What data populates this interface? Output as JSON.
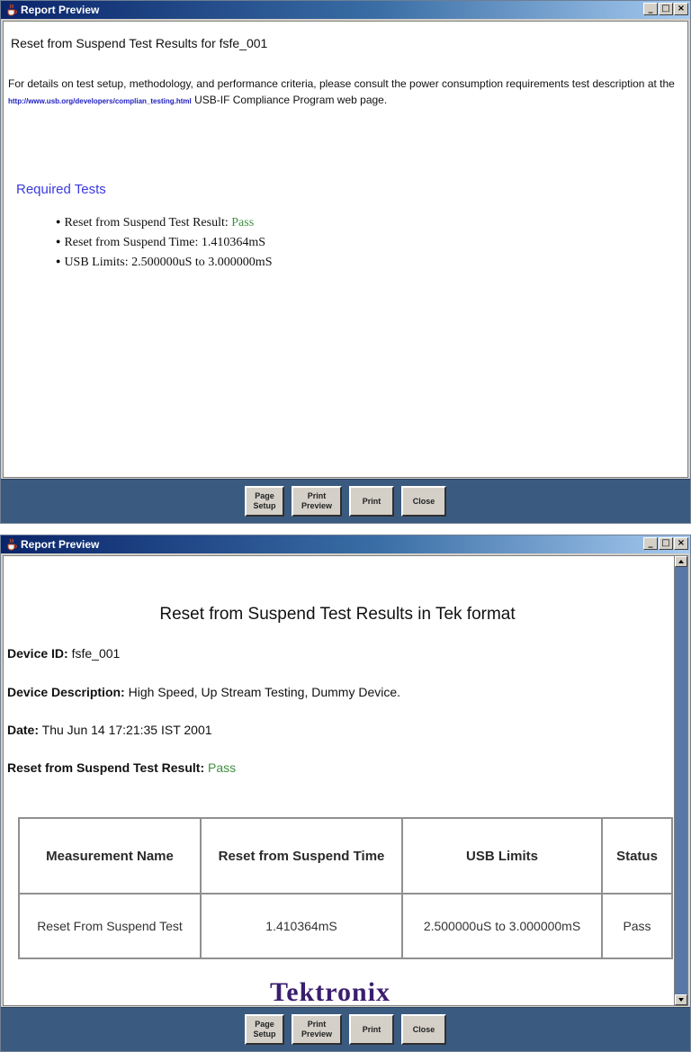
{
  "window1": {
    "title": "Report Preview",
    "heading": "Reset from Suspend Test Results for fsfe_001",
    "intro_before": "For details on test setup, methodology, and performance criteria, please consult the power consumption requirements test description at the",
    "url": "http://www.usb.org/developers/complian_testing.html",
    "intro_after": "USB-IF Compliance Program web page.",
    "required_heading": "Required Tests",
    "items": [
      {
        "label": "Reset from Suspend Test Result:",
        "value": "Pass"
      },
      {
        "label": "Reset from Suspend Time:",
        "value": "1.410364mS"
      },
      {
        "label": "USB Limits:",
        "value": "2.500000uS to 3.000000mS"
      }
    ],
    "buttons": {
      "page_setup": "Page\nSetup",
      "print_preview": "Print\nPreview",
      "print": "Print",
      "close": "Close"
    }
  },
  "window2": {
    "title": "Report Preview",
    "heading": "Reset from Suspend Test Results in Tek format",
    "device_id_label": "Device ID:",
    "device_id": "fsfe_001",
    "device_desc_label": "Device Description:",
    "device_desc": "High Speed, Up Stream Testing, Dummy Device.",
    "date_label": "Date:",
    "date": "Thu Jun 14 17:21:35 IST 2001",
    "result_label": "Reset from Suspend Test Result:",
    "result": "Pass",
    "table": {
      "headers": [
        "Measurement Name",
        "Reset from Suspend Time",
        "USB Limits",
        "Status"
      ],
      "rows": [
        [
          "Reset From Suspend Test",
          "1.410364mS",
          "2.500000uS to 3.000000mS",
          "Pass"
        ]
      ]
    },
    "logo": "Tektronix",
    "buttons": {
      "page_setup": "Page\nSetup",
      "print_preview": "Print\nPreview",
      "print": "Print",
      "close": "Close"
    }
  },
  "colors": {
    "title_bar": "#0a246a",
    "bottom_bar": "#3b5a7f",
    "pass": "#3f8f3f",
    "link": "#2020c0",
    "required_heading": "#3a3ae0"
  },
  "icons": [
    "java-cup-icon",
    "minimize-icon",
    "maximize-icon",
    "close-icon"
  ]
}
